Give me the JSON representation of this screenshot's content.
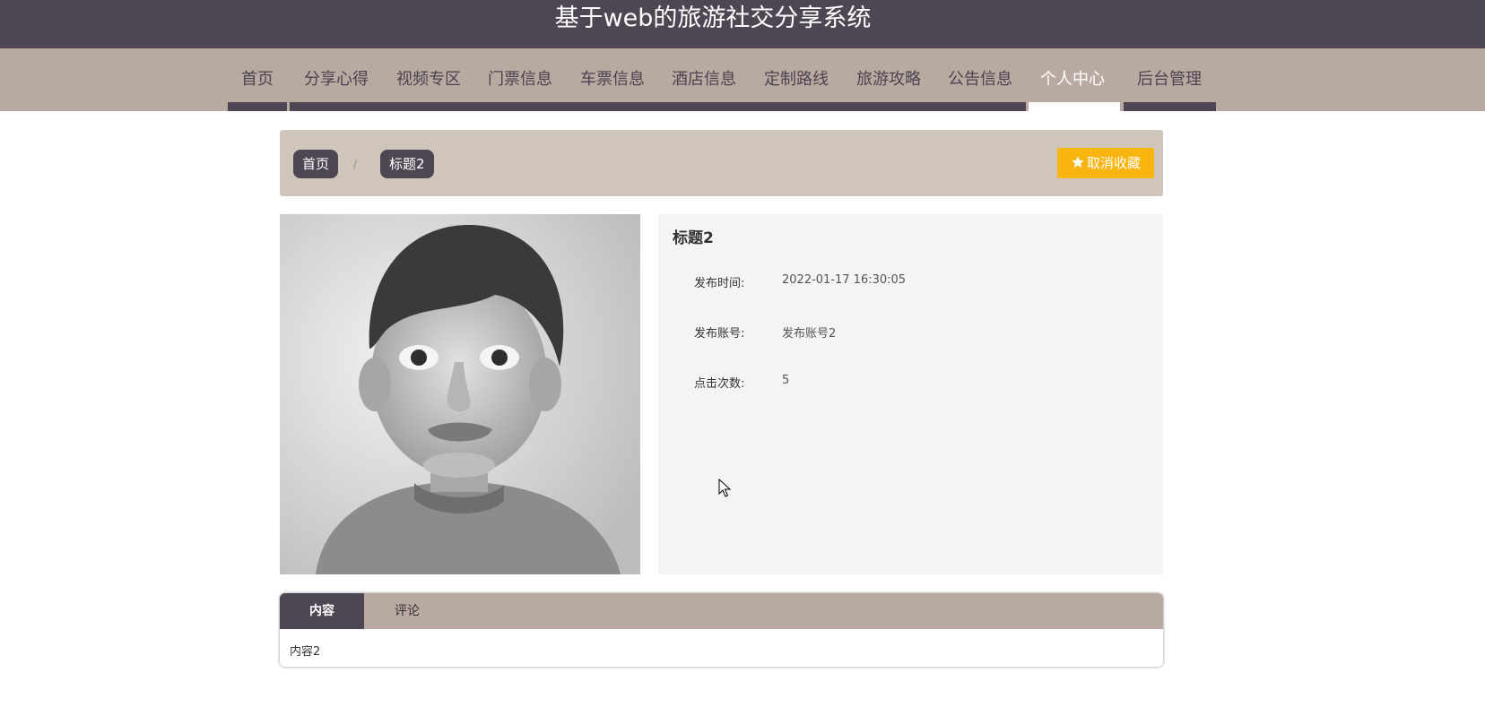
{
  "header": {
    "site_title": "基于web的旅游社交分享系统"
  },
  "nav": {
    "items": [
      {
        "label": "首页"
      },
      {
        "label": "分享心得"
      },
      {
        "label": "视频专区"
      },
      {
        "label": "门票信息"
      },
      {
        "label": "车票信息"
      },
      {
        "label": "酒店信息"
      },
      {
        "label": "定制路线"
      },
      {
        "label": "旅游攻略"
      },
      {
        "label": "公告信息"
      },
      {
        "label": "个人中心"
      },
      {
        "label": "后台管理"
      }
    ],
    "active": "个人中心"
  },
  "breadcrumb": {
    "home": "首页",
    "separator": "/",
    "current": "标题2"
  },
  "favorite_button": {
    "icon": "star-icon",
    "label": "取消收藏"
  },
  "detail": {
    "title": "标题2",
    "rows": [
      {
        "label": "发布时间:",
        "value": "2022-01-17 16:30:05"
      },
      {
        "label": "发布账号:",
        "value": "发布账号2"
      },
      {
        "label": "点击次数:",
        "value": "5"
      }
    ]
  },
  "tabs": {
    "items": [
      {
        "label": "内容"
      },
      {
        "label": "评论"
      }
    ],
    "active": "内容",
    "content": "内容2"
  },
  "colors": {
    "header_bg": "#4e4753",
    "nav_bg": "#b8a9a1",
    "breadcrumb_bg": "#cfc5bb",
    "favorite_button": "#f8b40f",
    "info_bg": "#f4f4f4"
  }
}
